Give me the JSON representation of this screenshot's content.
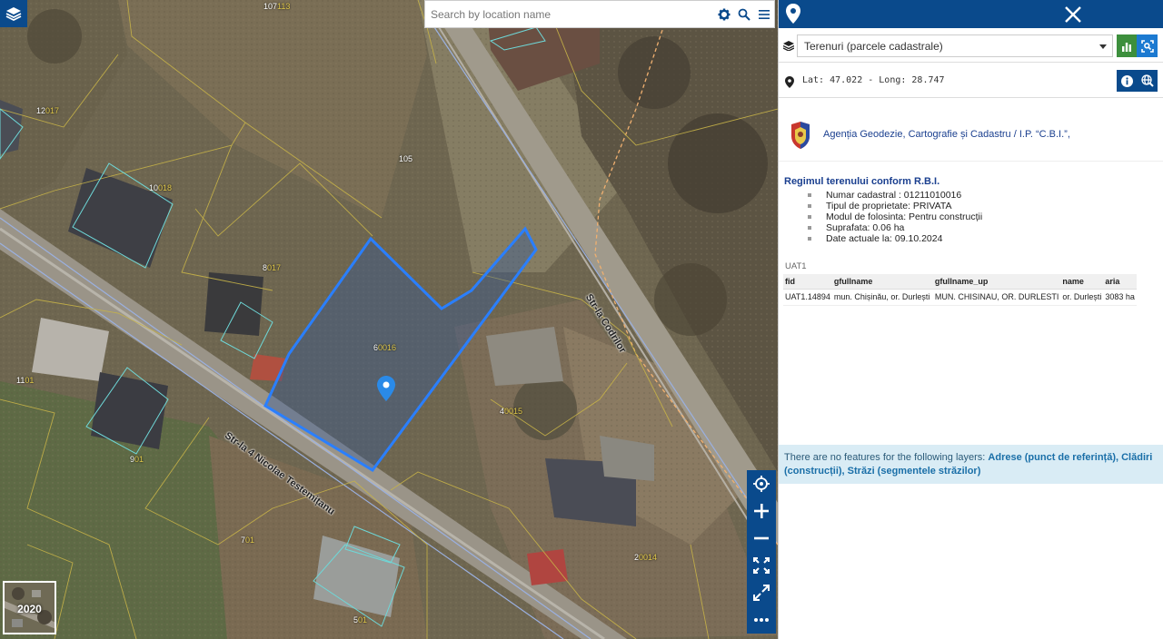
{
  "map": {
    "search_placeholder": "Search by location name",
    "year": "2020",
    "parcels": [
      {
        "num": "107",
        "sub": "113"
      },
      {
        "num": "12",
        "sub": "017"
      },
      {
        "num": "10",
        "sub": "018"
      },
      {
        "num": "105",
        "sub": ""
      },
      {
        "num": "8",
        "sub": "017"
      },
      {
        "num": "6",
        "sub": "0016"
      },
      {
        "num": "11",
        "sub": "01"
      },
      {
        "num": "9",
        "sub": "01"
      },
      {
        "num": "4",
        "sub": "0015"
      },
      {
        "num": "7",
        "sub": "01"
      },
      {
        "num": "2",
        "sub": "0014"
      },
      {
        "num": "5",
        "sub": "01"
      }
    ],
    "streets": {
      "street_a": "Str-la 4 Nicolae Testemițanu",
      "street_b": "Str-la Codrilor"
    }
  },
  "panel": {
    "layer_select": "Terenuri (parcele cadastrale)",
    "coords": "Lat: 47.022 - Long: 28.747",
    "org": "Agenția Geodezie, Cartografie și Cadastru / I.P. “C.B.I.”,",
    "regime_title": "Regimul terenului conform R.B.I.",
    "regime_items": [
      "Numar cadastral : 01211010016",
      "Tipul de proprietate: PRIVATA",
      "Modul de folosinta: Pentru construcții",
      "Suprafata: 0.06 ha",
      "Date actuale la: 09.10.2024"
    ],
    "uat": {
      "title": "UAT1",
      "headers": [
        "fid",
        "gfullname",
        "gfullname_up",
        "name",
        "aria"
      ],
      "row": [
        "UAT1.14894",
        "mun. Chișinău, or. Durlești",
        "MUN. CHISINAU, OR. DURLESTI",
        "or. Durlești",
        "3083 ha"
      ]
    },
    "nofeatures_text": "There are no features for the following layers: ",
    "nofeatures_layers": "Adrese (punct de referință), Clădiri (construcții), Străzi (segmentele străzilor)"
  },
  "colors": {
    "brand_blue": "#0a4a8c",
    "selected_parcel": "#2a7fff",
    "info_bar": "#d9ecf5",
    "chart_btn": "#3d8f3d"
  }
}
